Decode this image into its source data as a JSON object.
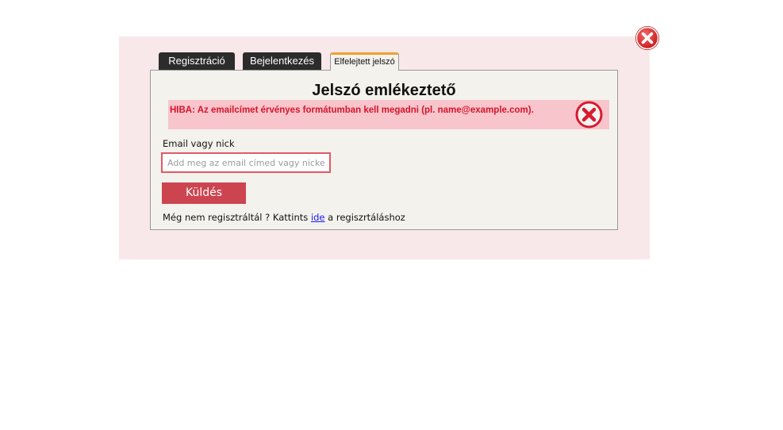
{
  "tabs": [
    {
      "label": "Regisztráció",
      "active": false
    },
    {
      "label": "Bejelentkezés",
      "active": false
    },
    {
      "label": "Elfelejtett jelszó",
      "active": true
    }
  ],
  "panel": {
    "title": "Jelszó emlékeztető",
    "error": {
      "message": "HIBA: Az emailcímet érvényes formátumban kell megadni (pl. name@example.com).",
      "icon": "error-x-icon"
    },
    "field_label": "Email vagy nick",
    "input": {
      "value": "",
      "placeholder": "Add meg az email címed vagy nicked..."
    },
    "submit_label": "Küldés",
    "footer": {
      "prefix": "Még nem regisztráltál ? Kattints ",
      "link_text": "ide",
      "suffix": " a regiszrtáláshoz"
    }
  },
  "close_icon": "close-x-icon",
  "colors": {
    "overlay_bg": "#f8e8ea",
    "panel_bg": "#f3f2ec",
    "error_bg": "#f7c5cb",
    "error_text": "#d9132a",
    "button_bg": "#cc4450",
    "active_tab_accent": "#f0a030",
    "tab_dark": "#2c2c2c"
  }
}
